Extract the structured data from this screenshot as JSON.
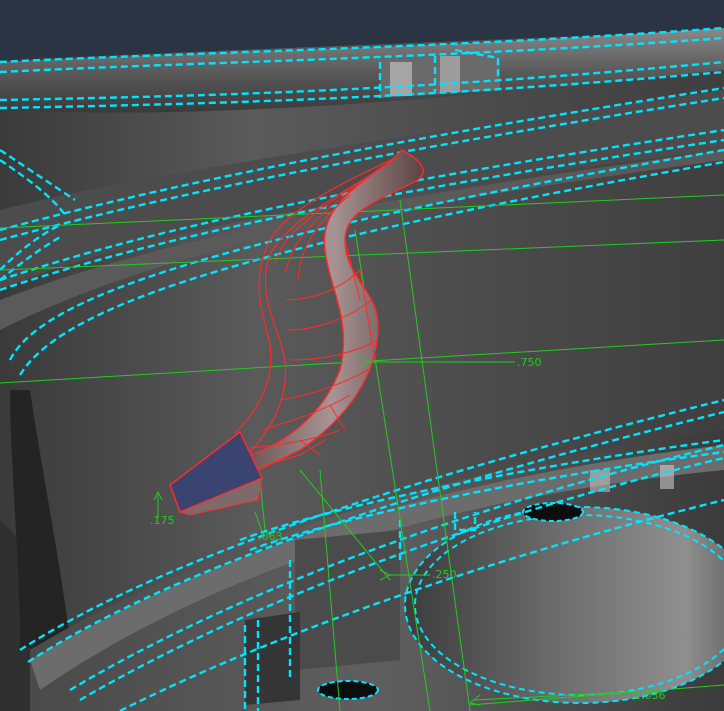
{
  "viewport": {
    "background": "#2b3442",
    "colors": {
      "edge_highlight": "#00e5ff",
      "sweep_path": "#ff2a2a",
      "profile_face": "#3a4470",
      "dimension": "#22cc22"
    }
  },
  "dimensions": {
    "d1": ".750",
    "d2": ".175",
    "d3": ".063",
    "d4": ".250",
    "d5": "2.036"
  }
}
